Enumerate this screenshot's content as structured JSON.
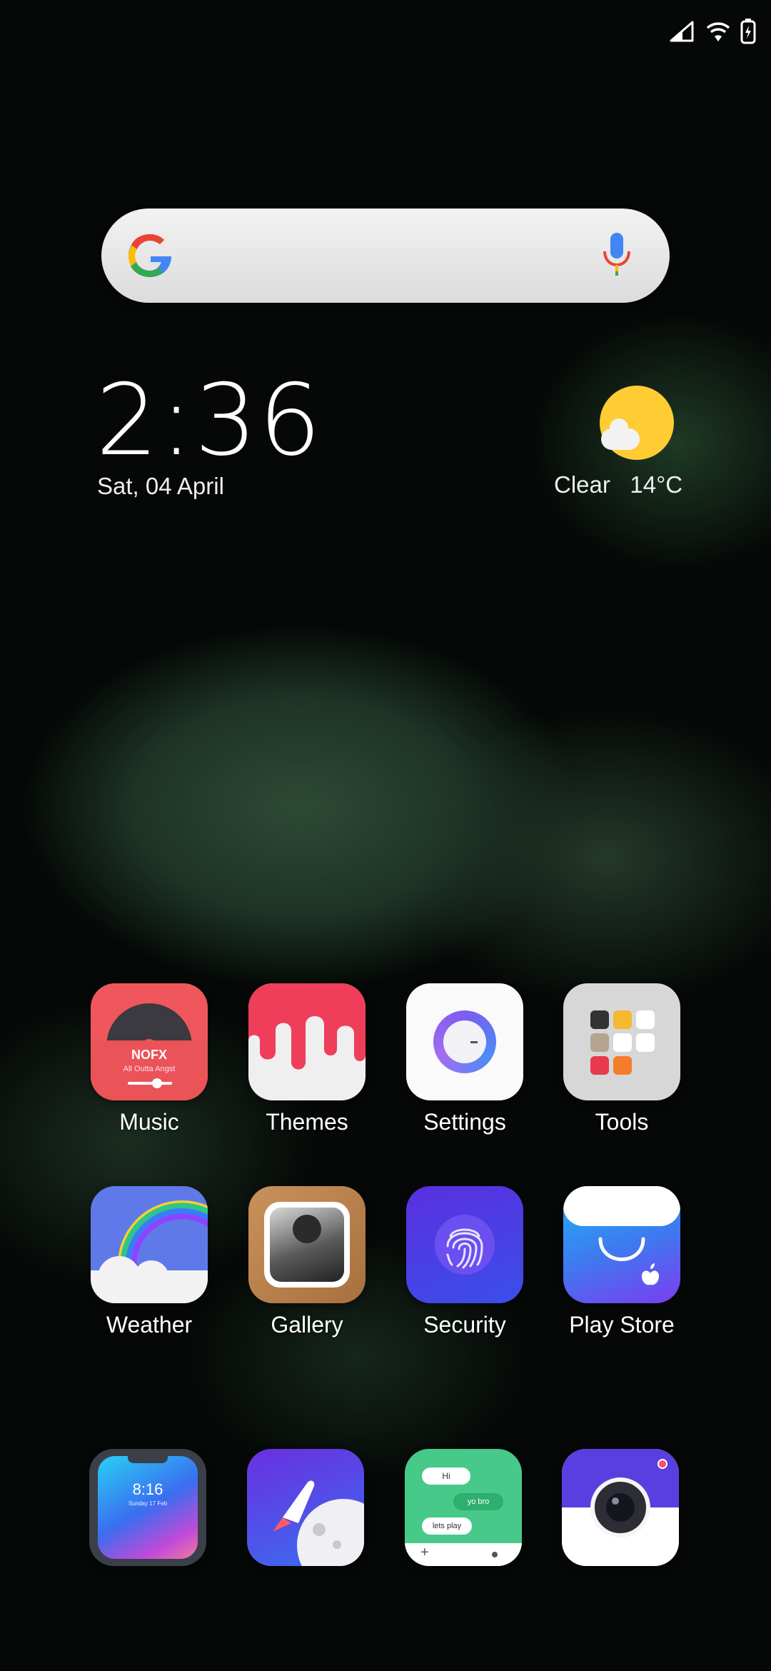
{
  "status_bar": {
    "icons": [
      "signal-icon",
      "wifi-icon",
      "battery-icon"
    ]
  },
  "search_bar": {
    "logo": "google-g-icon",
    "mic": "mic-icon"
  },
  "clock": {
    "time": "2:36",
    "date": "Sat, 04 April"
  },
  "weather_widget": {
    "condition": "Clear",
    "temperature": "14°C",
    "icon": "sun-cloud-icon"
  },
  "apps": [
    {
      "label": "Music",
      "icon": "music-icon",
      "song": "NOFX",
      "album": "All Outta Angst"
    },
    {
      "label": "Themes",
      "icon": "themes-icon"
    },
    {
      "label": "Settings",
      "icon": "settings-icon"
    },
    {
      "label": "Tools",
      "icon": "tools-folder-icon"
    },
    {
      "label": "Weather",
      "icon": "weather-icon"
    },
    {
      "label": "Gallery",
      "icon": "gallery-icon"
    },
    {
      "label": "Security",
      "icon": "fingerprint-icon"
    },
    {
      "label": "Play Store",
      "icon": "play-store-icon"
    }
  ],
  "dock": [
    {
      "icon": "phone-clock-icon",
      "time": "8:16",
      "date": "Sunday 17 Feb"
    },
    {
      "icon": "rocket-browser-icon"
    },
    {
      "icon": "messages-icon",
      "bubbles": [
        "Hi",
        "yo bro",
        "lets play"
      ]
    },
    {
      "icon": "camera-icon"
    }
  ],
  "colors": {
    "music": "#f0575c",
    "themes_red": "#ee3e5a",
    "settings_ring": "#6a55e6",
    "security": "#5a2fe0",
    "play_store": "#3d7bf0",
    "sun": "#ffcc33"
  }
}
